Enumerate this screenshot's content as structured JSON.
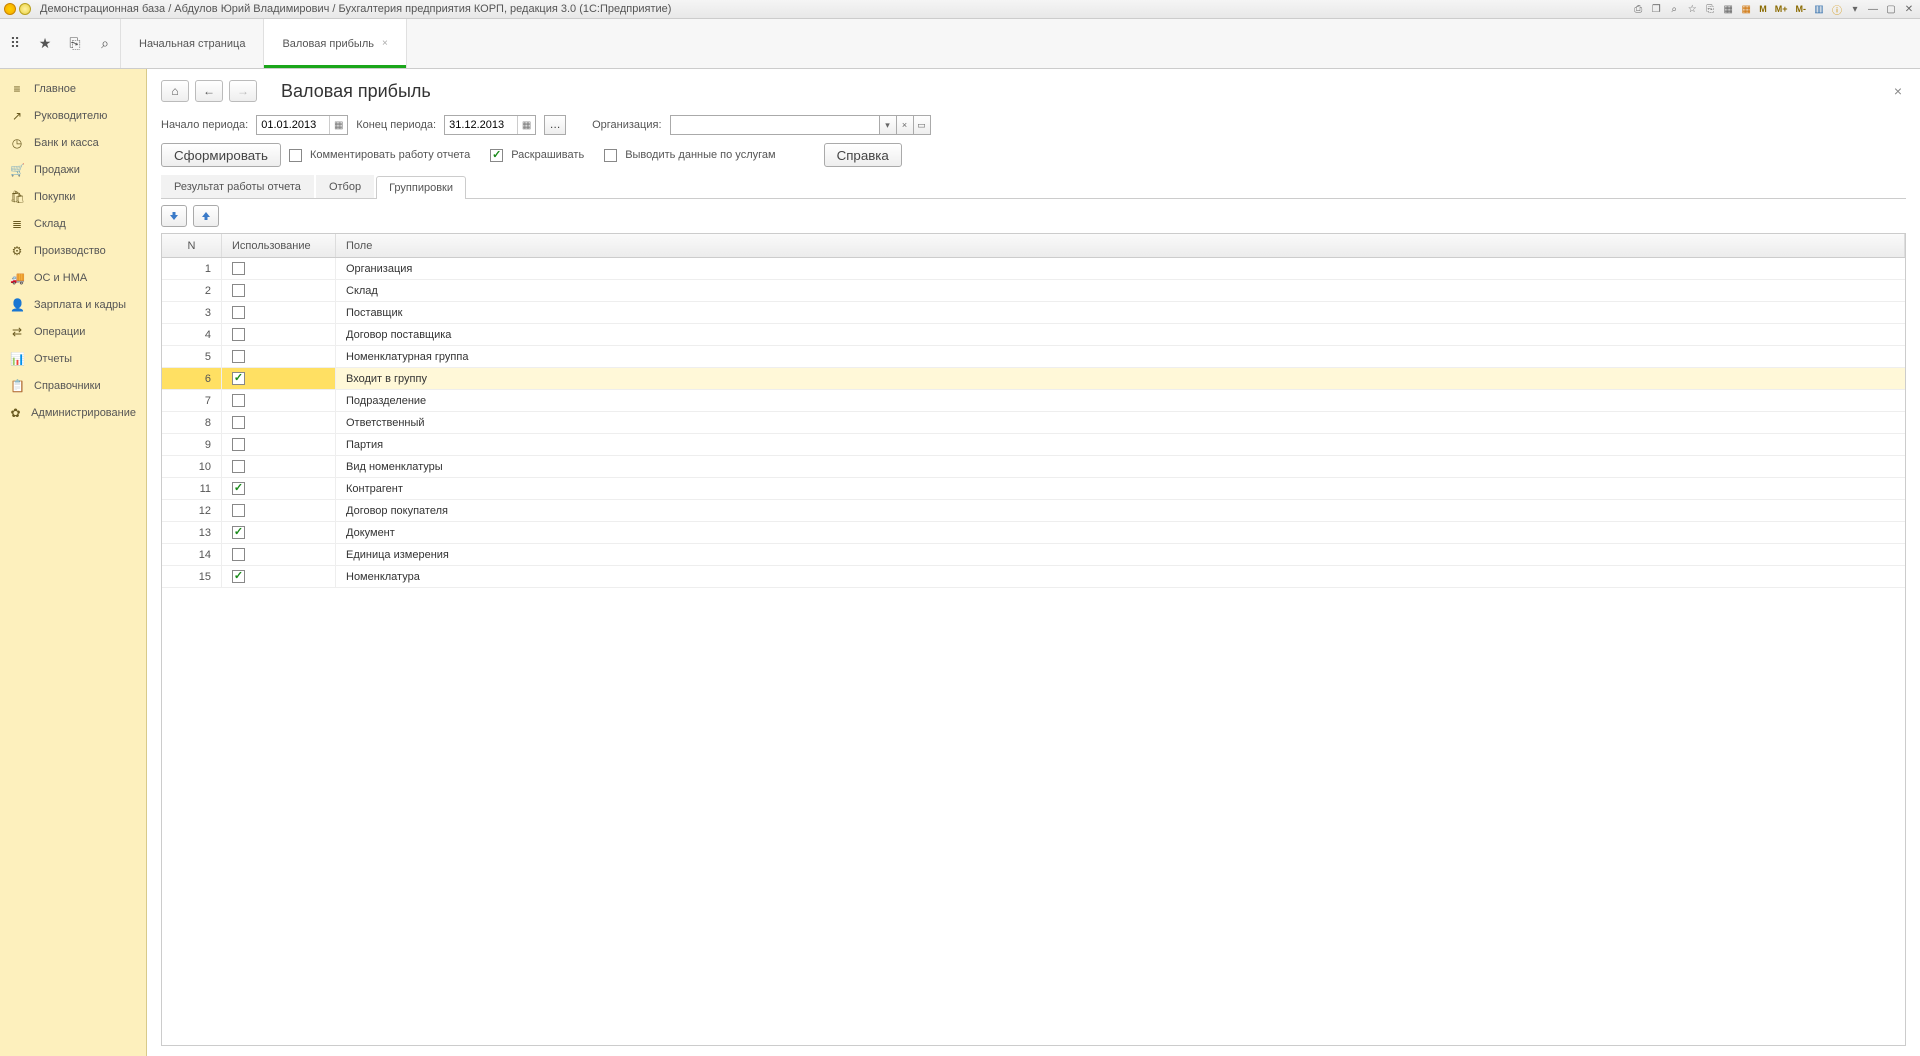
{
  "titlebar": {
    "title": "Демонстрационная база / Абдулов Юрий Владимирович / Бухгалтерия предприятия КОРП, редакция 3.0  (1С:Предприятие)",
    "icons": {
      "m": "M",
      "mplus": "M+",
      "mminus": "M-"
    }
  },
  "tabs": {
    "start": "Начальная страница",
    "active": "Валовая прибыль"
  },
  "sidebar": [
    {
      "icon": "≡",
      "label": "Главное"
    },
    {
      "icon": "↗",
      "label": "Руководителю"
    },
    {
      "icon": "◷",
      "label": "Банк и касса"
    },
    {
      "icon": "🛒",
      "label": "Продажи"
    },
    {
      "icon": "🛍",
      "label": "Покупки"
    },
    {
      "icon": "≣",
      "label": "Склад"
    },
    {
      "icon": "⚙",
      "label": "Производство"
    },
    {
      "icon": "🚚",
      "label": "ОС и НМА"
    },
    {
      "icon": "👤",
      "label": "Зарплата и кадры"
    },
    {
      "icon": "⇄",
      "label": "Операции"
    },
    {
      "icon": "📊",
      "label": "Отчеты"
    },
    {
      "icon": "📋",
      "label": "Справочники"
    },
    {
      "icon": "✿",
      "label": "Администрирование"
    }
  ],
  "page": {
    "title": "Валовая прибыль",
    "period_start_label": "Начало периода:",
    "period_start": "01.01.2013",
    "period_end_label": "Конец периода:",
    "period_end": "31.12.2013",
    "org_label": "Организация:",
    "org_value": "",
    "form_btn": "Сформировать",
    "comment_label": "Комментировать работу отчета",
    "colorize_label": "Раскрашивать",
    "services_label": "Выводить данные по услугам",
    "help_btn": "Справка"
  },
  "subtabs": {
    "result": "Результат работы отчета",
    "filter": "Отбор",
    "group": "Группировки"
  },
  "grid": {
    "headers": {
      "n": "N",
      "use": "Использование",
      "field": "Поле"
    },
    "rows": [
      {
        "n": 1,
        "used": false,
        "field": "Организация"
      },
      {
        "n": 2,
        "used": false,
        "field": "Склад"
      },
      {
        "n": 3,
        "used": false,
        "field": "Поставщик"
      },
      {
        "n": 4,
        "used": false,
        "field": "Договор поставщика"
      },
      {
        "n": 5,
        "used": false,
        "field": "Номенклатурная группа"
      },
      {
        "n": 6,
        "used": true,
        "field": "Входит в группу",
        "selected": true
      },
      {
        "n": 7,
        "used": false,
        "field": "Подразделение"
      },
      {
        "n": 8,
        "used": false,
        "field": "Ответственный"
      },
      {
        "n": 9,
        "used": false,
        "field": "Партия"
      },
      {
        "n": 10,
        "used": false,
        "field": "Вид номенклатуры"
      },
      {
        "n": 11,
        "used": true,
        "field": "Контрагент"
      },
      {
        "n": 12,
        "used": false,
        "field": "Договор покупателя"
      },
      {
        "n": 13,
        "used": true,
        "field": "Документ"
      },
      {
        "n": 14,
        "used": false,
        "field": "Единица измерения"
      },
      {
        "n": 15,
        "used": true,
        "field": "Номенклатура"
      }
    ]
  }
}
